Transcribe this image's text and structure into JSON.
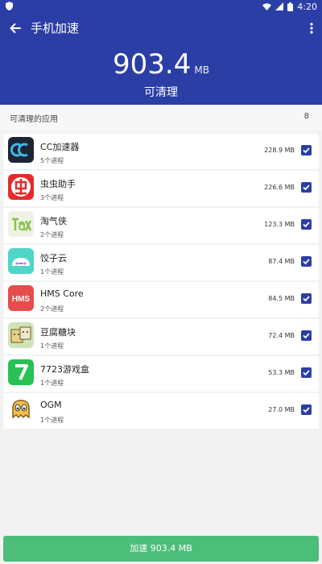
{
  "status_bar": {
    "time": "4:20",
    "icons": [
      "shield-icon",
      "wifi-icon",
      "signal-icon",
      "battery-icon"
    ]
  },
  "header": {
    "title": "手机加速",
    "amount": "903.4",
    "unit": "MB",
    "subtitle": "可清理",
    "background": "#2b3ea6"
  },
  "section": {
    "label": "可清理的应用",
    "count": "8"
  },
  "apps": [
    {
      "name": "CC加速器",
      "processes": "5个进程",
      "size": "228.9 MB",
      "checked": true,
      "icon": "cc-accelerator-icon"
    },
    {
      "name": "虫虫助手",
      "processes": "3个进程",
      "size": "226.6 MB",
      "checked": true,
      "icon": "chongchong-icon"
    },
    {
      "name": "淘气侠",
      "processes": "2个进程",
      "size": "123.3 MB",
      "checked": true,
      "icon": "taoqixia-icon"
    },
    {
      "name": "饺子云",
      "processes": "1个进程",
      "size": "87.4 MB",
      "checked": true,
      "icon": "jiaoziyun-icon"
    },
    {
      "name": "HMS Core",
      "processes": "2个进程",
      "size": "84.5 MB",
      "checked": true,
      "icon": "hms-core-icon",
      "icon_text": "HMS"
    },
    {
      "name": "豆腐糖块",
      "processes": "1个进程",
      "size": "72.4 MB",
      "checked": true,
      "icon": "doufu-icon"
    },
    {
      "name": "7723游戏盒",
      "processes": "1个进程",
      "size": "53.3 MB",
      "checked": true,
      "icon": "game-box-7723-icon"
    },
    {
      "name": "OGM",
      "processes": "1个进程",
      "size": "27.0 MB",
      "checked": true,
      "icon": "ogm-icon"
    }
  ],
  "accelerate_button": {
    "label": "加速 903.4 MB",
    "color": "#4dbd7a"
  }
}
